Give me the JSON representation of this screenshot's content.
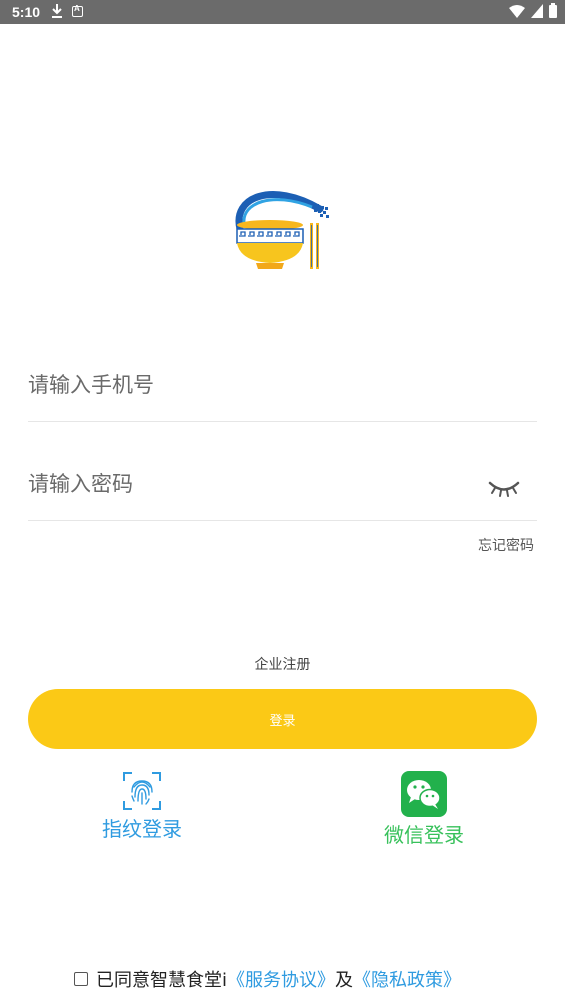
{
  "status_bar": {
    "time": "5:10",
    "icons": [
      "download-icon",
      "a-badge-icon",
      "wifi-icon",
      "signal-icon",
      "battery-icon"
    ]
  },
  "form": {
    "phone_placeholder": "请输入手机号",
    "password_placeholder": "请输入密码",
    "forgot_password": "忘记密码"
  },
  "register_label": "企业注册",
  "login_label": "登录",
  "alt_logins": {
    "fingerprint_label": "指纹登录",
    "wechat_label": "微信登录"
  },
  "agreement": {
    "prefix": "已同意智慧食堂i",
    "service_link": "《服务协议》",
    "joiner": "及",
    "privacy_link": "《隐私政策》"
  },
  "colors": {
    "accent": "#fbc916",
    "link_blue": "#2f9be0",
    "wechat_green": "#38c15b"
  }
}
